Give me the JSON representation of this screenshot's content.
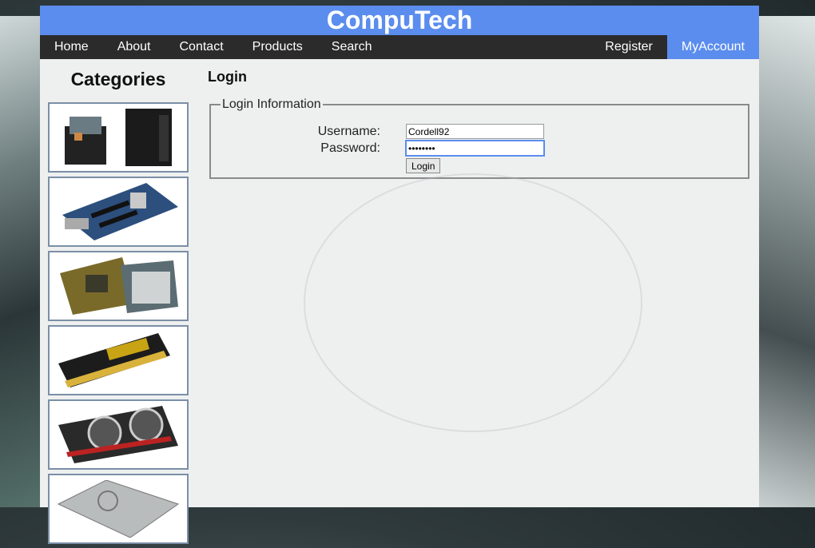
{
  "site": {
    "title": "CompuTech"
  },
  "nav": {
    "items": [
      "Home",
      "About",
      "Contact",
      "Products",
      "Search"
    ],
    "right": [
      "Register",
      "MyAccount"
    ],
    "active": "MyAccount"
  },
  "sidebar": {
    "title": "Categories",
    "categories": [
      {
        "icon": "desktop-computers-icon"
      },
      {
        "icon": "motherboard-icon"
      },
      {
        "icon": "cpu-processor-icon"
      },
      {
        "icon": "memory-ram-icon"
      },
      {
        "icon": "graphics-card-icon"
      },
      {
        "icon": "hard-drive-icon"
      }
    ]
  },
  "login": {
    "heading": "Login",
    "legend": "Login Information",
    "username_label": "Username:",
    "password_label": "Password:",
    "username_value": "Cordell92",
    "password_value": "••••••••",
    "submit_label": "Login"
  },
  "colors": {
    "accent": "#5b8dee",
    "navbar": "#2b2b2b",
    "page": "#eef0f0"
  }
}
